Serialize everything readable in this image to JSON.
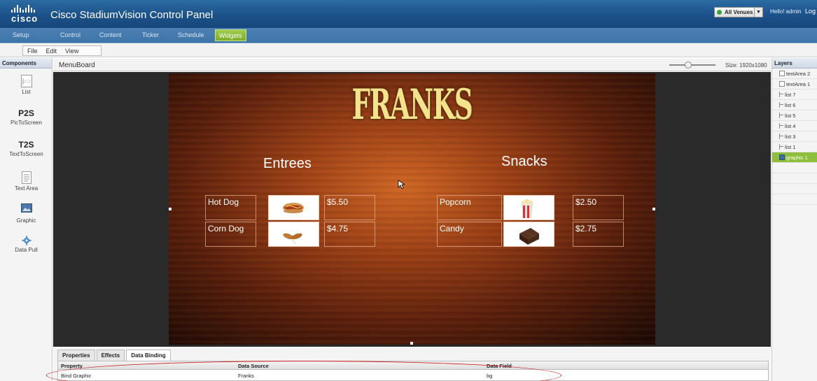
{
  "header": {
    "logo_text": "cisco",
    "title": "Cisco StadiumVision Control Panel",
    "venue_select": "All Venues",
    "greeting": "Hello! admin",
    "logout": "Log"
  },
  "nav": {
    "tabs": [
      {
        "label": "Setup"
      },
      {
        "label": "Control"
      },
      {
        "label": "Content"
      },
      {
        "label": "Ticker"
      },
      {
        "label": "Schedule"
      },
      {
        "label": "Widgets",
        "active": true
      }
    ]
  },
  "menubar": {
    "items": [
      "File",
      "Edit",
      "View"
    ]
  },
  "components": {
    "header": "Components",
    "items": [
      {
        "icon": "list-icon",
        "label": "List"
      },
      {
        "icon_text": "P2S",
        "label": "PicToScreen"
      },
      {
        "icon_text": "T2S",
        "label": "TextToScreen"
      },
      {
        "icon": "text-area-icon",
        "label": "Text Area"
      },
      {
        "icon": "graphic-icon",
        "label": "Graphic"
      },
      {
        "icon": "gear-icon",
        "label": "Data Pull"
      }
    ]
  },
  "canvas": {
    "title": "MenuBoard",
    "size_label": "Size: 1920x1080",
    "board": {
      "title": "FRANKS",
      "sections": [
        {
          "heading": "Entrees",
          "rows": [
            {
              "name": "Hot Dog",
              "price": "$5.50",
              "image": "hot-dog-image"
            },
            {
              "name": "Corn Dog",
              "price": "$4.75",
              "image": "corn-dog-image"
            }
          ]
        },
        {
          "heading": "Snacks",
          "rows": [
            {
              "name": "Popcorn",
              "price": "$2.50",
              "image": "popcorn-image"
            },
            {
              "name": "Candy",
              "price": "$2.75",
              "image": "candy-image"
            }
          ]
        }
      ]
    }
  },
  "layers": {
    "header": "Layers",
    "items": [
      {
        "label": "textArea 2",
        "icon": "text-area-icon"
      },
      {
        "label": "textArea 1",
        "icon": "text-area-icon"
      },
      {
        "label": "list 7",
        "icon": "list-icon"
      },
      {
        "label": "list 6",
        "icon": "list-icon"
      },
      {
        "label": "list 5",
        "icon": "list-icon"
      },
      {
        "label": "list 4",
        "icon": "list-icon"
      },
      {
        "label": "list 3",
        "icon": "list-icon"
      },
      {
        "label": "list 1",
        "icon": "list-icon"
      },
      {
        "label": "graphic 1",
        "icon": "graphic-icon",
        "selected": true
      }
    ]
  },
  "bottom_panel": {
    "tabs": [
      {
        "label": "Properties"
      },
      {
        "label": "Effects"
      },
      {
        "label": "Data Binding",
        "active": true
      }
    ],
    "table": {
      "columns": [
        "Property",
        "Data Source",
        "Data Field"
      ],
      "rows": [
        [
          "Bind Graphic",
          "Franks",
          "bg"
        ]
      ]
    }
  },
  "colors": {
    "header_blue": "#1c5189",
    "active_tab_green": "#8fbf3a",
    "title_yellow": "#f3e38c",
    "highlight_red": "#c92020"
  }
}
